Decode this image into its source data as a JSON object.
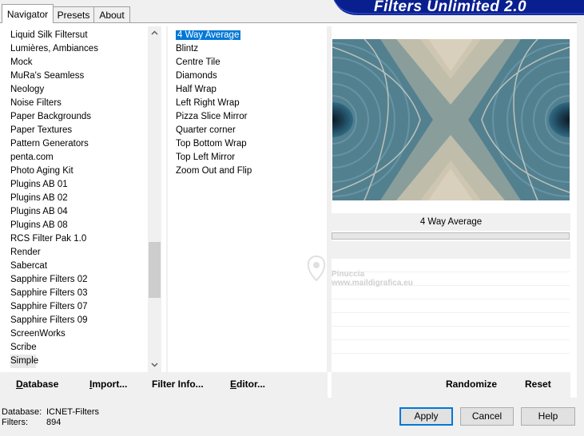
{
  "tabs": [
    {
      "label": "Navigator"
    },
    {
      "label": "Presets"
    },
    {
      "label": "About"
    }
  ],
  "banner": {
    "title": "Filters Unlimited 2.0"
  },
  "categories": [
    "Liquid Silk Filtersut",
    "Lumières, Ambiances",
    "Mock",
    "MuRa's Seamless",
    "Neology",
    "Noise Filters",
    "Paper Backgrounds",
    "Paper Textures",
    "Pattern Generators",
    "penta.com",
    "Photo Aging Kit",
    "Plugins AB 01",
    "Plugins AB 02",
    "Plugins AB 04",
    "Plugins AB 08",
    "RCS Filter Pak 1.0",
    "Render",
    "Sabercat",
    "Sapphire Filters 02",
    "Sapphire Filters 03",
    "Sapphire Filters 07",
    "Sapphire Filters 09",
    "ScreenWorks",
    "Scribe",
    "Simple"
  ],
  "selected_category": "Simple",
  "filters": [
    "4 Way Average",
    "Blintz",
    "Centre Tile",
    "Diamonds",
    "Half Wrap",
    "Left Right Wrap",
    "Pizza Slice Mirror",
    "Quarter corner",
    "Top Bottom Wrap",
    "Top Left Mirror",
    "Zoom Out and Flip"
  ],
  "selected_filter": "4 Way Average",
  "preview": {
    "filter_name": "4 Way Average"
  },
  "watermark": {
    "line1": "Pinuccia",
    "line2": "www.maildigrafica.eu"
  },
  "left_buttons": {
    "database": "Database",
    "import": "Import...",
    "filter_info": "Filter Info...",
    "editor": "Editor..."
  },
  "right_buttons": {
    "randomize": "Randomize",
    "reset": "Reset"
  },
  "status": {
    "database_label": "Database:",
    "database_value": "ICNET-Filters",
    "filters_label": "Filters:",
    "filters_value": "894"
  },
  "dialog_buttons": {
    "apply": "Apply",
    "cancel": "Cancel",
    "help": "Help"
  },
  "colors": {
    "selection": "#0078d7",
    "banner": "#0a1f8f",
    "preview_teal": "#2f6c84",
    "preview_beige": "#cfc6b2"
  },
  "icons": {
    "scroll_up": "chevron-up-icon",
    "scroll_down": "chevron-down-icon"
  }
}
